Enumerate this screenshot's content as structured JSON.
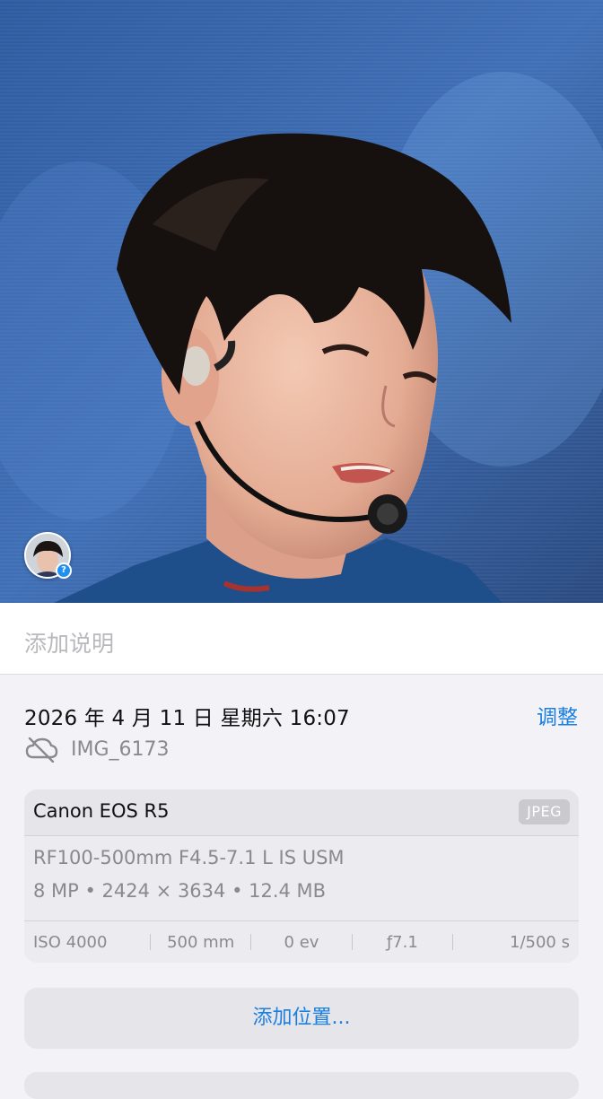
{
  "photo": {
    "caption_placeholder": "添加说明",
    "people_badge": "?"
  },
  "info": {
    "datetime": "2026 年 4 月 11 日  星期六 16:07",
    "adjust_label": "调整",
    "cloud_icon": "icloud-slash-icon",
    "filename": "IMG_6173"
  },
  "exif": {
    "camera": "Canon EOS R5",
    "format": "JPEG",
    "lens": "RF100-500mm F4.5-7.1 L IS USM",
    "specs": "8 MP • 2424 × 3634 • 12.4 MB",
    "iso": "ISO 4000",
    "focal_length": "500 mm",
    "exposure_bias": "0 ev",
    "aperture": "ƒ7.1",
    "shutter": "1/500 s"
  },
  "location": {
    "add_label": "添加位置..."
  },
  "colors": {
    "accent": "#1a7fe0",
    "background": "#f2f2f7",
    "secondary_text": "#8a8a8e"
  }
}
